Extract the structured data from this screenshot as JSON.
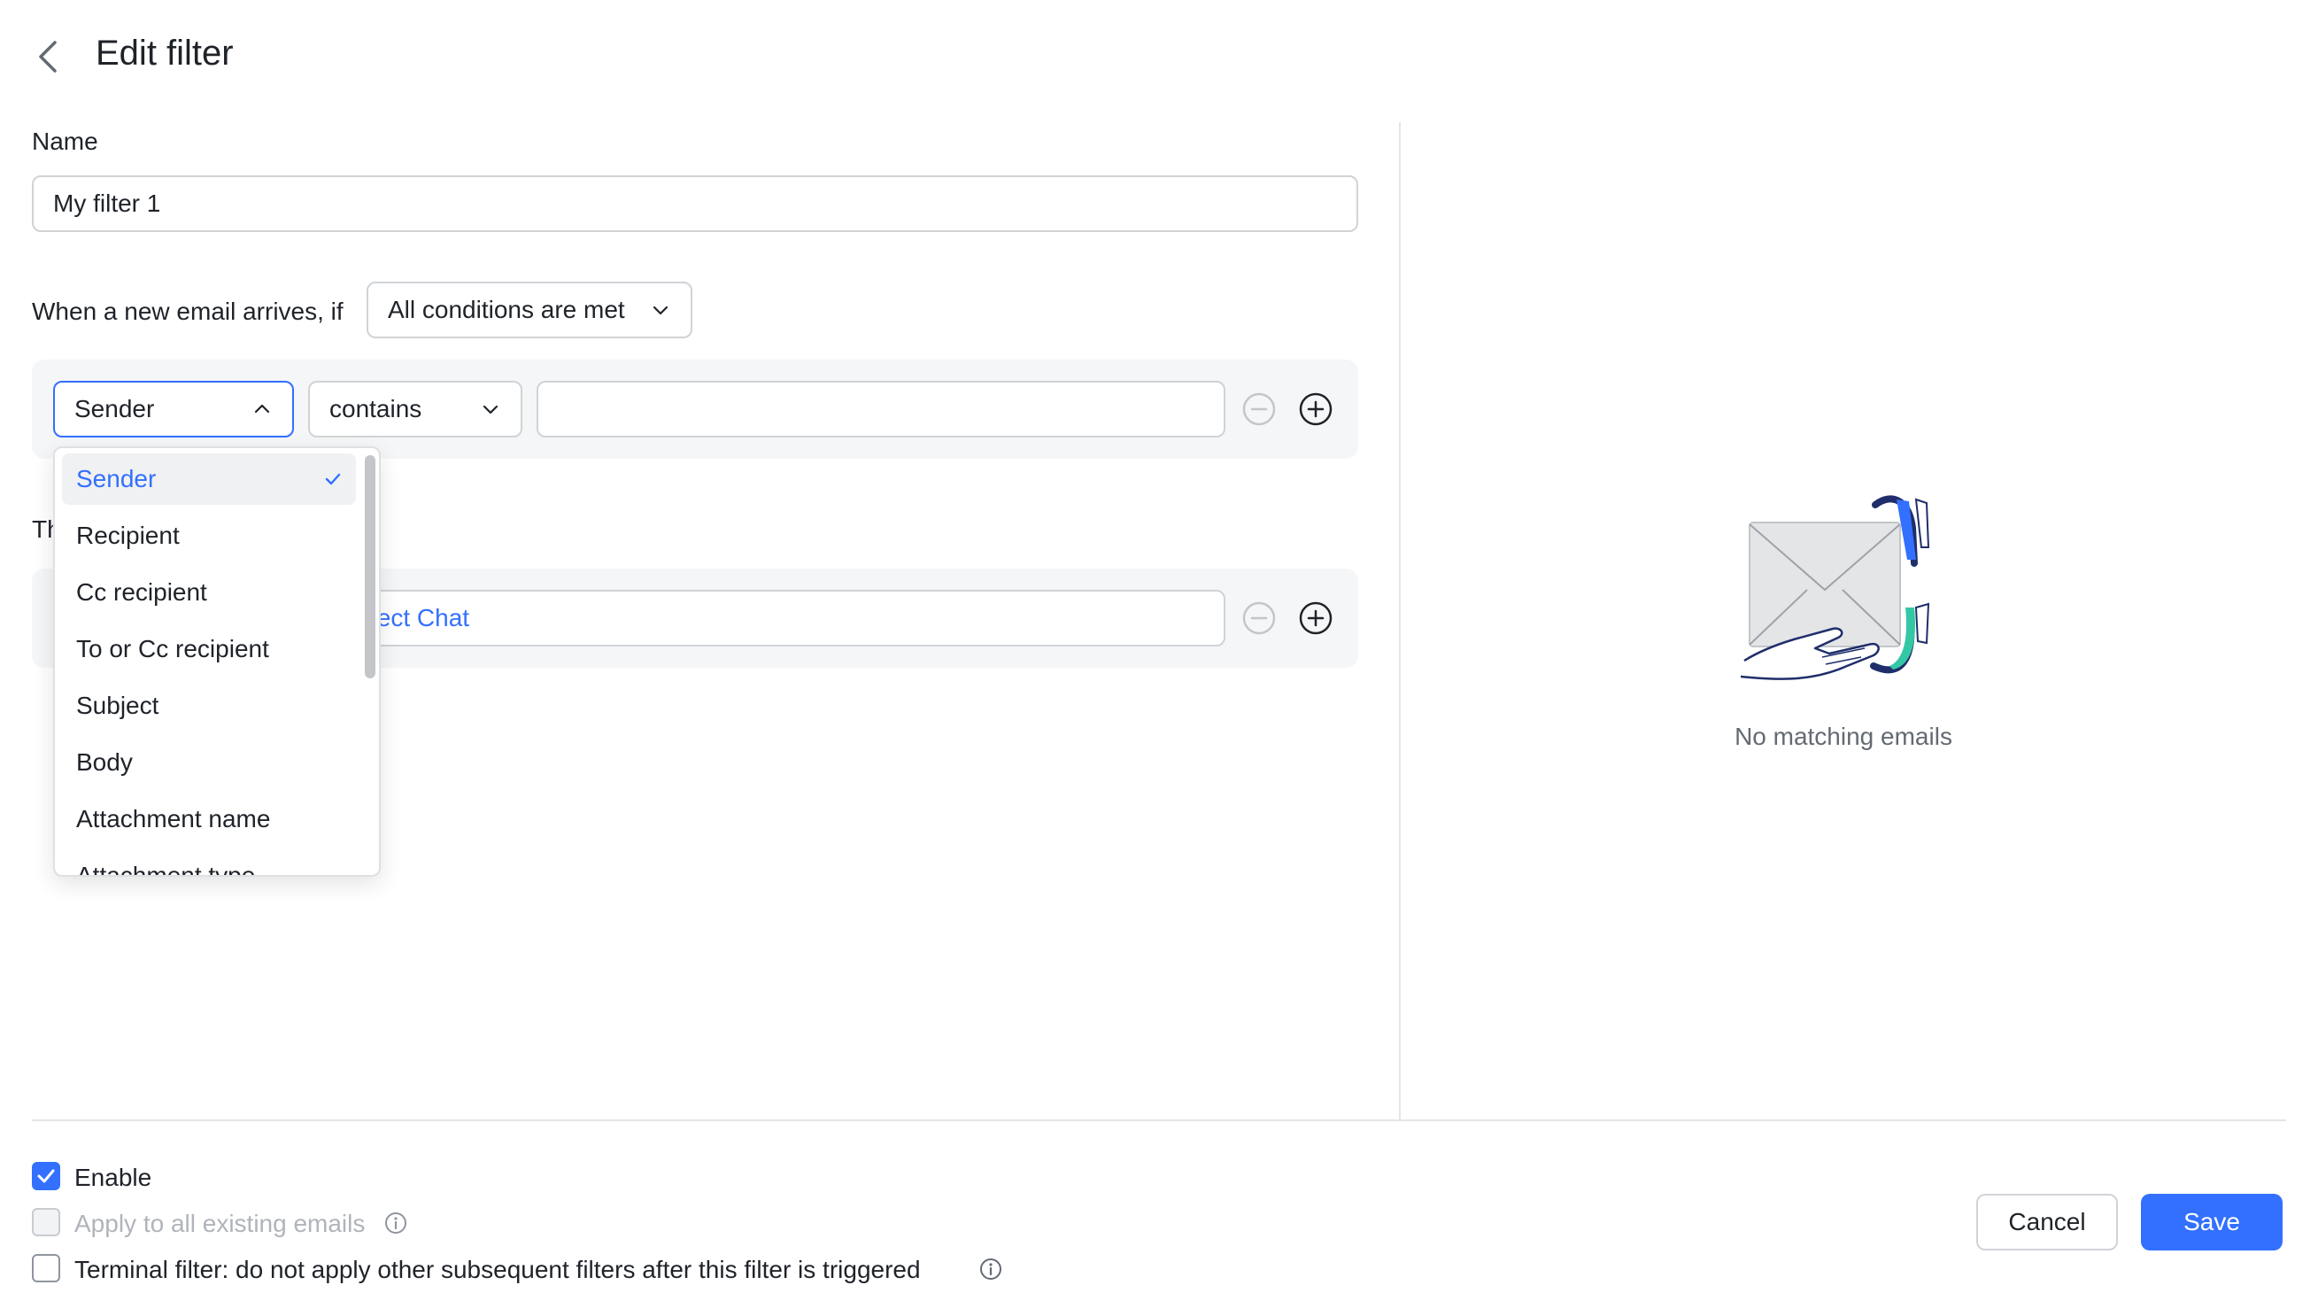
{
  "header": {
    "title": "Edit filter"
  },
  "name_section": {
    "label": "Name",
    "value": "My filter 1"
  },
  "condition_section": {
    "prefix": "When a new email arrives, if",
    "match_mode": "All conditions are met",
    "rule": {
      "field": "Sender",
      "operator": "contains",
      "value": ""
    }
  },
  "action_section": {
    "label_partial": "Th",
    "action_text": "elect Chat"
  },
  "field_dropdown": {
    "items": [
      "Sender",
      "Recipient",
      "Cc recipient",
      "To or Cc recipient",
      "Subject",
      "Body",
      "Attachment name",
      "Attachment type"
    ],
    "selected": "Sender"
  },
  "preview": {
    "empty_text": "No matching emails"
  },
  "footer": {
    "enable": {
      "label": "Enable",
      "checked": true
    },
    "apply_existing": {
      "label": "Apply to all existing emails",
      "checked": false,
      "disabled": true
    },
    "terminal": {
      "label": "Terminal filter: do not apply other subsequent filters after this filter is triggered",
      "checked": false
    },
    "cancel_label": "Cancel",
    "save_label": "Save"
  },
  "colors": {
    "accent": "#3370ff",
    "text": "#1f2329",
    "muted": "#646a73",
    "border": "#d0d3d6",
    "panel": "#f5f6f7"
  }
}
